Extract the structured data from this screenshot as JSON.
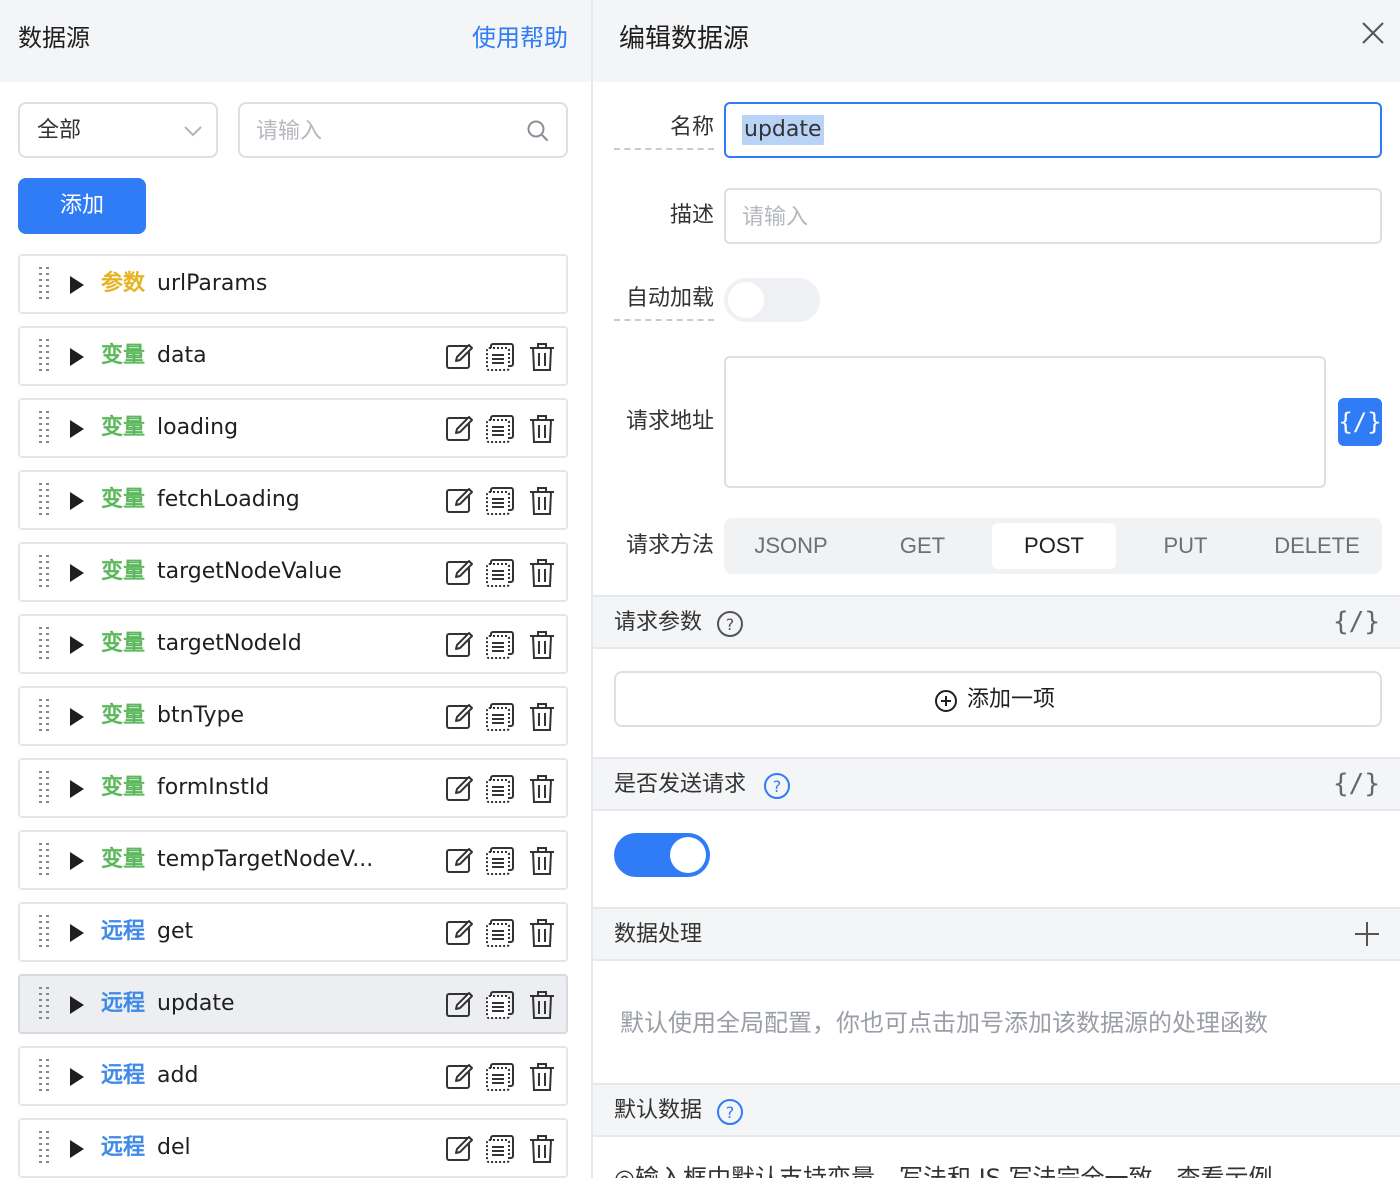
{
  "left": {
    "title": "数据源",
    "help_link": "使用帮助",
    "filter_value": "全部",
    "search_placeholder": "请输入",
    "add_button": "添加",
    "items": [
      {
        "type": "参数",
        "type_color": "#e6b325",
        "name": "urlParams",
        "actions": false,
        "active": false
      },
      {
        "type": "变量",
        "type_color": "#5cb85c",
        "name": "data",
        "actions": true,
        "active": false
      },
      {
        "type": "变量",
        "type_color": "#5cb85c",
        "name": "loading",
        "actions": true,
        "active": false
      },
      {
        "type": "变量",
        "type_color": "#5cb85c",
        "name": "fetchLoading",
        "actions": true,
        "active": false
      },
      {
        "type": "变量",
        "type_color": "#5cb85c",
        "name": "targetNodeValue",
        "actions": true,
        "active": false
      },
      {
        "type": "变量",
        "type_color": "#5cb85c",
        "name": "targetNodeId",
        "actions": true,
        "active": false
      },
      {
        "type": "变量",
        "type_color": "#5cb85c",
        "name": "btnType",
        "actions": true,
        "active": false
      },
      {
        "type": "变量",
        "type_color": "#5cb85c",
        "name": "formInstId",
        "actions": true,
        "active": false
      },
      {
        "type": "变量",
        "type_color": "#5cb85c",
        "name": "tempTargetNodeV...",
        "actions": true,
        "active": false
      },
      {
        "type": "远程",
        "type_color": "#3f8ae8",
        "name": "get",
        "actions": true,
        "active": false
      },
      {
        "type": "远程",
        "type_color": "#3f8ae8",
        "name": "update",
        "actions": true,
        "active": true
      },
      {
        "type": "远程",
        "type_color": "#3f8ae8",
        "name": "add",
        "actions": true,
        "active": false
      },
      {
        "type": "远程",
        "type_color": "#3f8ae8",
        "name": "del",
        "actions": true,
        "active": false
      }
    ]
  },
  "right": {
    "title": "编辑数据源",
    "name_label": "名称",
    "name_value": "update",
    "desc_label": "描述",
    "desc_placeholder": "请输入",
    "autoload_label": "自动加载",
    "autoload_on": false,
    "url_label": "请求地址",
    "code_symbol": "{/}",
    "method_label": "请求方法",
    "methods": [
      "JSONP",
      "GET",
      "POST",
      "PUT",
      "DELETE"
    ],
    "selected_method": "POST",
    "params_section": "请求参数",
    "add_item": "添加一项",
    "send_section": "是否发送请求",
    "send_on": true,
    "process_section": "数据处理",
    "process_hint": "默认使用全局配置，你也可点击加号添加该数据源的处理函数",
    "default_section": "默认数据",
    "default_hint": "◎输入框中默认支持变量，写法和 JS 写法完全一致，查看示例"
  },
  "colors": {
    "primary": "#2f7cf6",
    "param": "#e6b325",
    "variable": "#5cb85c",
    "remote": "#3f8ae8"
  }
}
